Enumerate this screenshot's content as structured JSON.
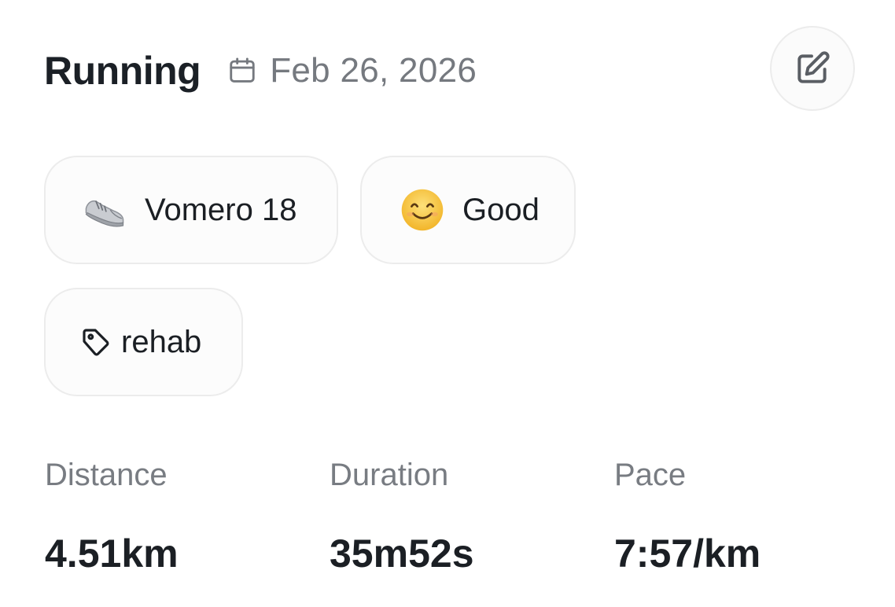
{
  "activity": {
    "title": "Running",
    "date": "Feb 26, 2026"
  },
  "chips": {
    "shoe": {
      "label": "Vomero 18",
      "icon": "running-shoe-icon"
    },
    "mood": {
      "label": "Good",
      "icon": "smiling-face-icon"
    },
    "tag": {
      "label": "rehab",
      "icon": "tag-icon"
    }
  },
  "stats": {
    "distance": {
      "label": "Distance",
      "value": "4.51km"
    },
    "duration": {
      "label": "Duration",
      "value": "35m52s"
    },
    "pace": {
      "label": "Pace",
      "value": "7:57/km"
    }
  },
  "colors": {
    "title": "#1b2026",
    "muted": "#75797f",
    "chip_border": "#ececec",
    "emoji_face": "#f5c341"
  }
}
